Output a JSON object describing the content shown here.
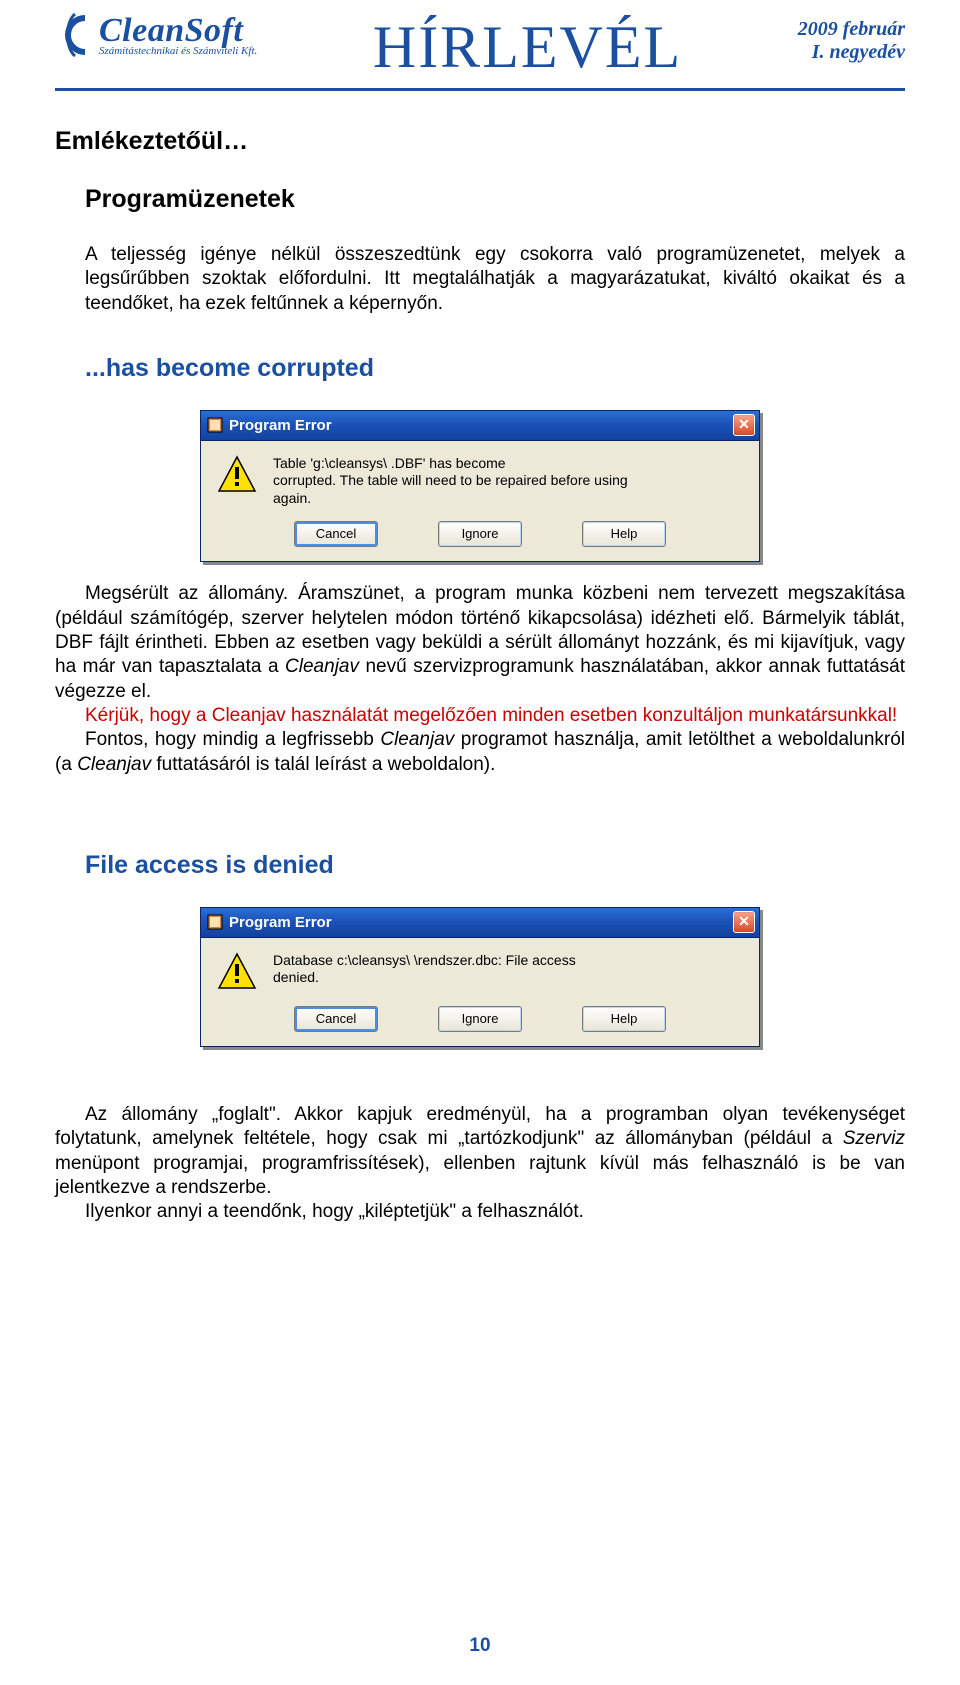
{
  "header": {
    "brand": "CleanSoft",
    "tagline": "Számítástechnikai és Számviteli Kft.",
    "center_title": "HÍRLEVÉL",
    "date_line1": "2009 február",
    "date_line2": "I. negyedév"
  },
  "content": {
    "h1": "Emlékeztetőül…",
    "h2": "Programüzenetek",
    "intro": "A teljesség igénye nélkül összeszedtünk egy csokorra való programüzenetet, melyek a legsűrűbben szoktak előfordulni. Itt megtalálhatják a magyarázatukat, kiváltó okaikat és a teendőket, ha ezek feltűnnek a képernyőn.",
    "section1_h": "...has become corrupted",
    "section2_h": "File access is denied",
    "para1a": "Megsérült az állomány. Áramszünet, a program munka közbeni nem tervezett megszakítása (például számítógép, szerver helytelen módon történő kikapcsolása) idézheti elő. Bármelyik táblát, DBF fájlt érintheti. Ebben az esetben vagy beküldi a sérült állományt hozzánk, és mi kijavítjuk, vagy ha már van tapasztalata a ",
    "para1a_ital1": "Cleanjav",
    "para1a_cont": " nevű szervizprogramunk használatában, akkor annak futtatását végezze el.",
    "para1_red": "Kérjük, hogy a Cleanjav használatát megelőzően minden esetben konzultáljon munkatársunkkal!",
    "para1b_pre": "Fontos, hogy mindig a legfrissebb ",
    "para1b_ital": "Cleanjav",
    "para1b_mid": " programot használja, amit letölthet a weboldalunkról (a ",
    "para1b_ital2": "Cleanjav",
    "para1b_end": " futtatásáról is talál leírást a weboldalon).",
    "para2a_pre": "Az állomány „foglalt\". Akkor kapjuk eredményül, ha a programban olyan tevékenységet folytatunk, amelynek feltétele, hogy csak mi „tartózkodjunk\" az állományban (például a ",
    "para2a_ital": "Szerviz",
    "para2a_end": " menüpont programjai, programfrissítések), ellenben rajtunk kívül más felhasználó is be van jelentkezve a rendszerbe.",
    "para2b": "Ilyenkor annyi a teendőnk, hogy „kiléptetjük\" a felhasználót."
  },
  "dialog1": {
    "title": "Program Error",
    "msg_line1": "Table 'g:\\cleansys\\                                    .DBF' has become",
    "msg_line2": "corrupted. The table will need to be repaired before using",
    "msg_line3": "again.",
    "btn_cancel": "Cancel",
    "btn_ignore": "Ignore",
    "btn_help": "Help"
  },
  "dialog2": {
    "title": "Program Error",
    "msg_line1": "Database c:\\cleansys\\                    \\rendszer.dbc: File access",
    "msg_line2": "denied.",
    "btn_cancel": "Cancel",
    "btn_ignore": "Ignore",
    "btn_help": "Help"
  },
  "page_number": "10"
}
